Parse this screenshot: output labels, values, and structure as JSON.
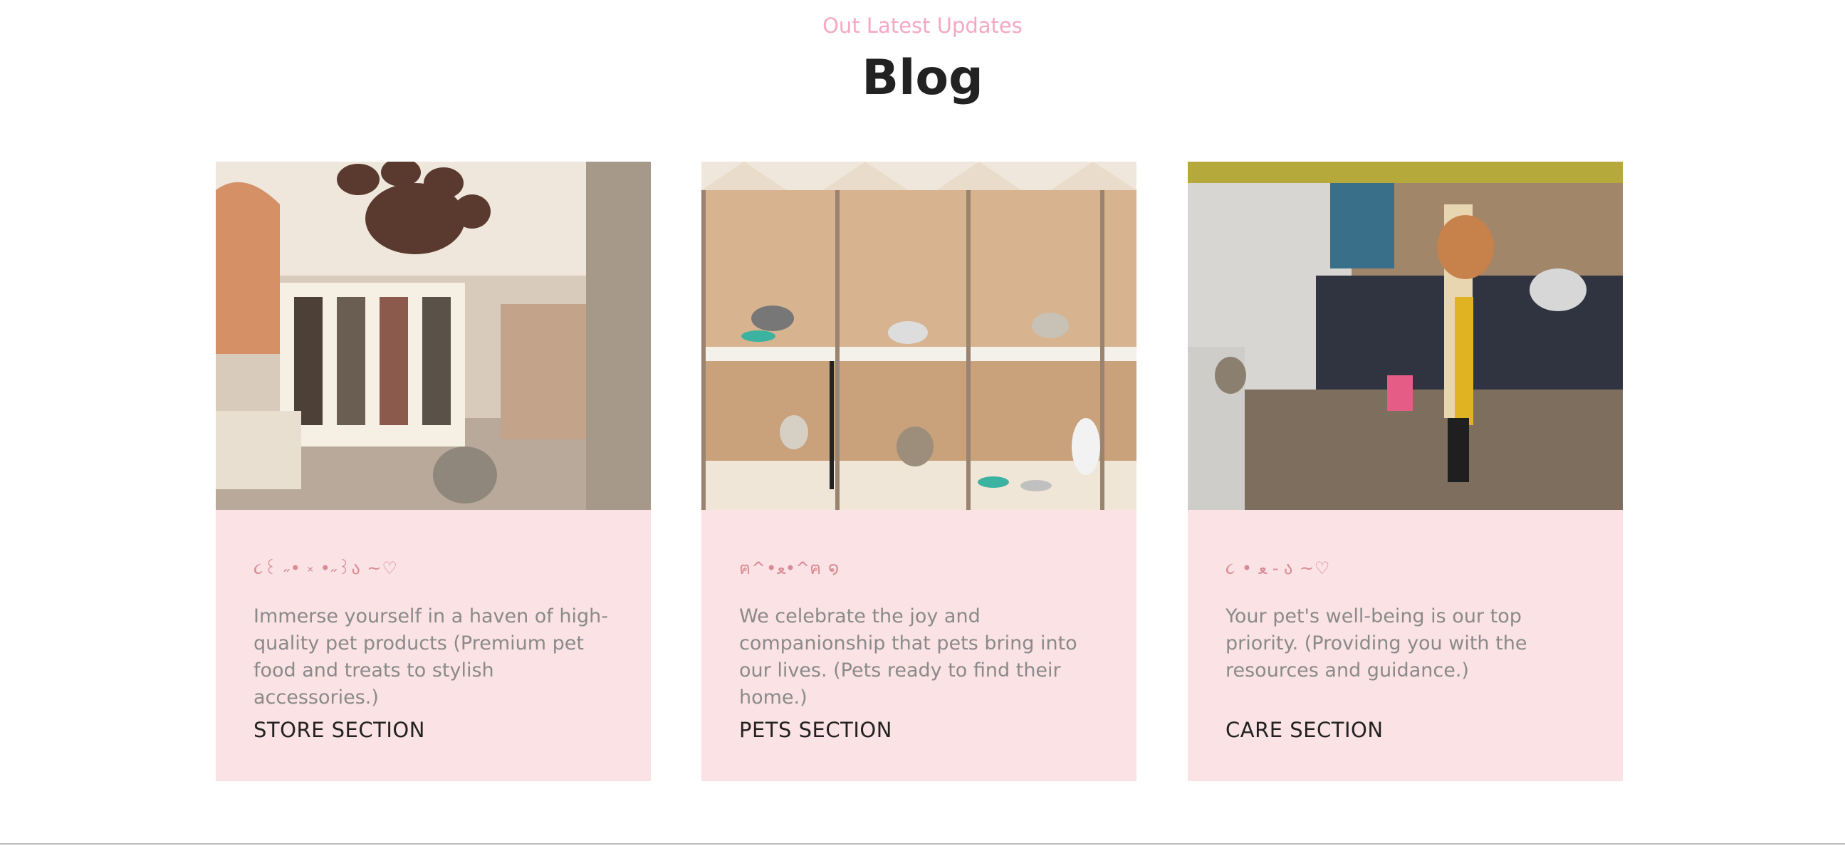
{
  "header": {
    "eyebrow": "Out Latest Updates",
    "title": "Blog"
  },
  "colors": {
    "accent_pink": "#f5a8c4",
    "card_background": "#fbe2e4",
    "kaomoji_color": "#d98a93",
    "body_text": "#8a8a8a",
    "heading_text": "#222222"
  },
  "cards": [
    {
      "image_subject": "pet-store-interior-photo",
      "kaomoji": "૮꒰ ˶• ༝ •˶꒱ა ~♡",
      "text": "Immerse yourself in a haven of high-quality pet products (Premium pet food and treats to stylish accessories.)",
      "link_label": "STORE SECTION"
    },
    {
      "image_subject": "pet-kennels-photo",
      "kaomoji": "ฅ^•ﻌ•^ฅ ໑",
      "text": "We celebrate the joy and companionship that pets bring into our lives. (Pets ready to find their home.)",
      "link_label": "PETS SECTION"
    },
    {
      "image_subject": "pet-grooming-photo",
      "kaomoji": "૮ • ﻌ - ა ~♡",
      "text": "Your pet's well-being is our top priority. (Providing you with the resources and guidance.)",
      "link_label": "CARE SECTION"
    }
  ]
}
